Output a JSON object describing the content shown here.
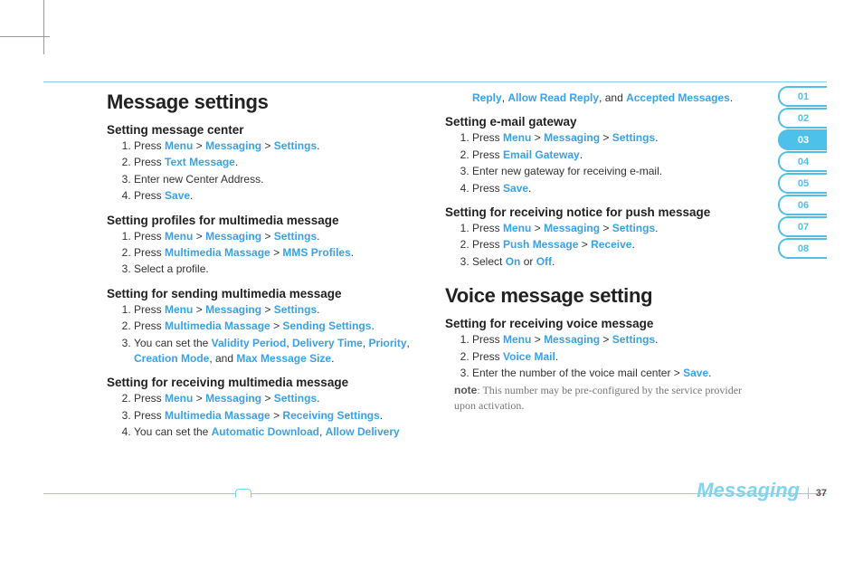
{
  "h1a": "Message settings",
  "s1": {
    "title": "Setting message center",
    "i1a": "Press ",
    "i1b": "Menu",
    "i1c": "Messaging",
    "i1d": "Settings",
    "i2a": "Press ",
    "i2b": "Text Message",
    "i3": "Enter new Center Address.",
    "i4a": "Press ",
    "i4b": "Save"
  },
  "s2": {
    "title": "Setting profiles for multimedia message",
    "i1a": "Press ",
    "i1b": "Menu",
    "i1c": "Messaging",
    "i1d": "Settings",
    "i2a": "Press ",
    "i2b": "Multimedia Massage",
    "i2c": "MMS Profiles",
    "i3": "Select a profile."
  },
  "s3": {
    "title": "Setting for sending multimedia message",
    "i1a": "Press ",
    "i1b": "Menu",
    "i1c": "Messaging",
    "i1d": "Settings",
    "i2a": "Press ",
    "i2b": "Multimedia Massage",
    "i2c": "Sending Settings",
    "i3a": "You can set the ",
    "i3b": "Validity Period",
    "i3c": "Delivery Time",
    "i3d": "Priority",
    "i3e": "Creation Mode",
    "i3f": "Max Message Size"
  },
  "s4": {
    "title": "Setting for receiving multimedia message",
    "i2a": "Press ",
    "i2b": "Menu",
    "i2c": "Messaging",
    "i2d": "Settings",
    "i3a": "Press ",
    "i3b": "Multimedia Massage",
    "i3c": "Receiving Settings",
    "i4a": "You can set the ",
    "i4b": "Automatic Download",
    "i4c": "Allow Delivery "
  },
  "cont": {
    "a": "Reply",
    "b": "Allow Read Reply",
    "c": "Accepted Messages"
  },
  "s5": {
    "title": "Setting e-mail gateway",
    "i1a": "Press ",
    "i1b": "Menu",
    "i1c": "Messaging",
    "i1d": "Settings",
    "i2a": "Press ",
    "i2b": "Email Gateway",
    "i3": "Enter new gateway for receiving e-mail.",
    "i4a": "Press ",
    "i4b": "Save"
  },
  "s6": {
    "title": "Setting for receiving notice for push message",
    "i1a": "Press ",
    "i1b": "Menu",
    "i1c": "Messaging",
    "i1d": "Settings",
    "i2a": "Press ",
    "i2b": "Push Message",
    "i2c": "Receive",
    "i3a": "Select ",
    "i3b": "On",
    "i3c": " or ",
    "i3d": "Off"
  },
  "h1b": "Voice message setting",
  "s7": {
    "title": "Setting for receiving voice message",
    "i1a": "Press ",
    "i1b": "Menu",
    "i1c": "Messaging",
    "i1d": "Settings",
    "i2a": "Press ",
    "i2b": "Voice Mail",
    "i3a": "Enter the number of the voice mail center > ",
    "i3b": "Save"
  },
  "note": {
    "lbl": "note",
    "body": ": This number may be pre-configured by the service provider upon activation."
  },
  "chapter": "Messaging",
  "page": "37",
  "tabs": {
    "t1": "01",
    "t2": "02",
    "t3": "03",
    "t4": "04",
    "t5": "05",
    "t6": "06",
    "t7": "07",
    "t8": "08"
  }
}
